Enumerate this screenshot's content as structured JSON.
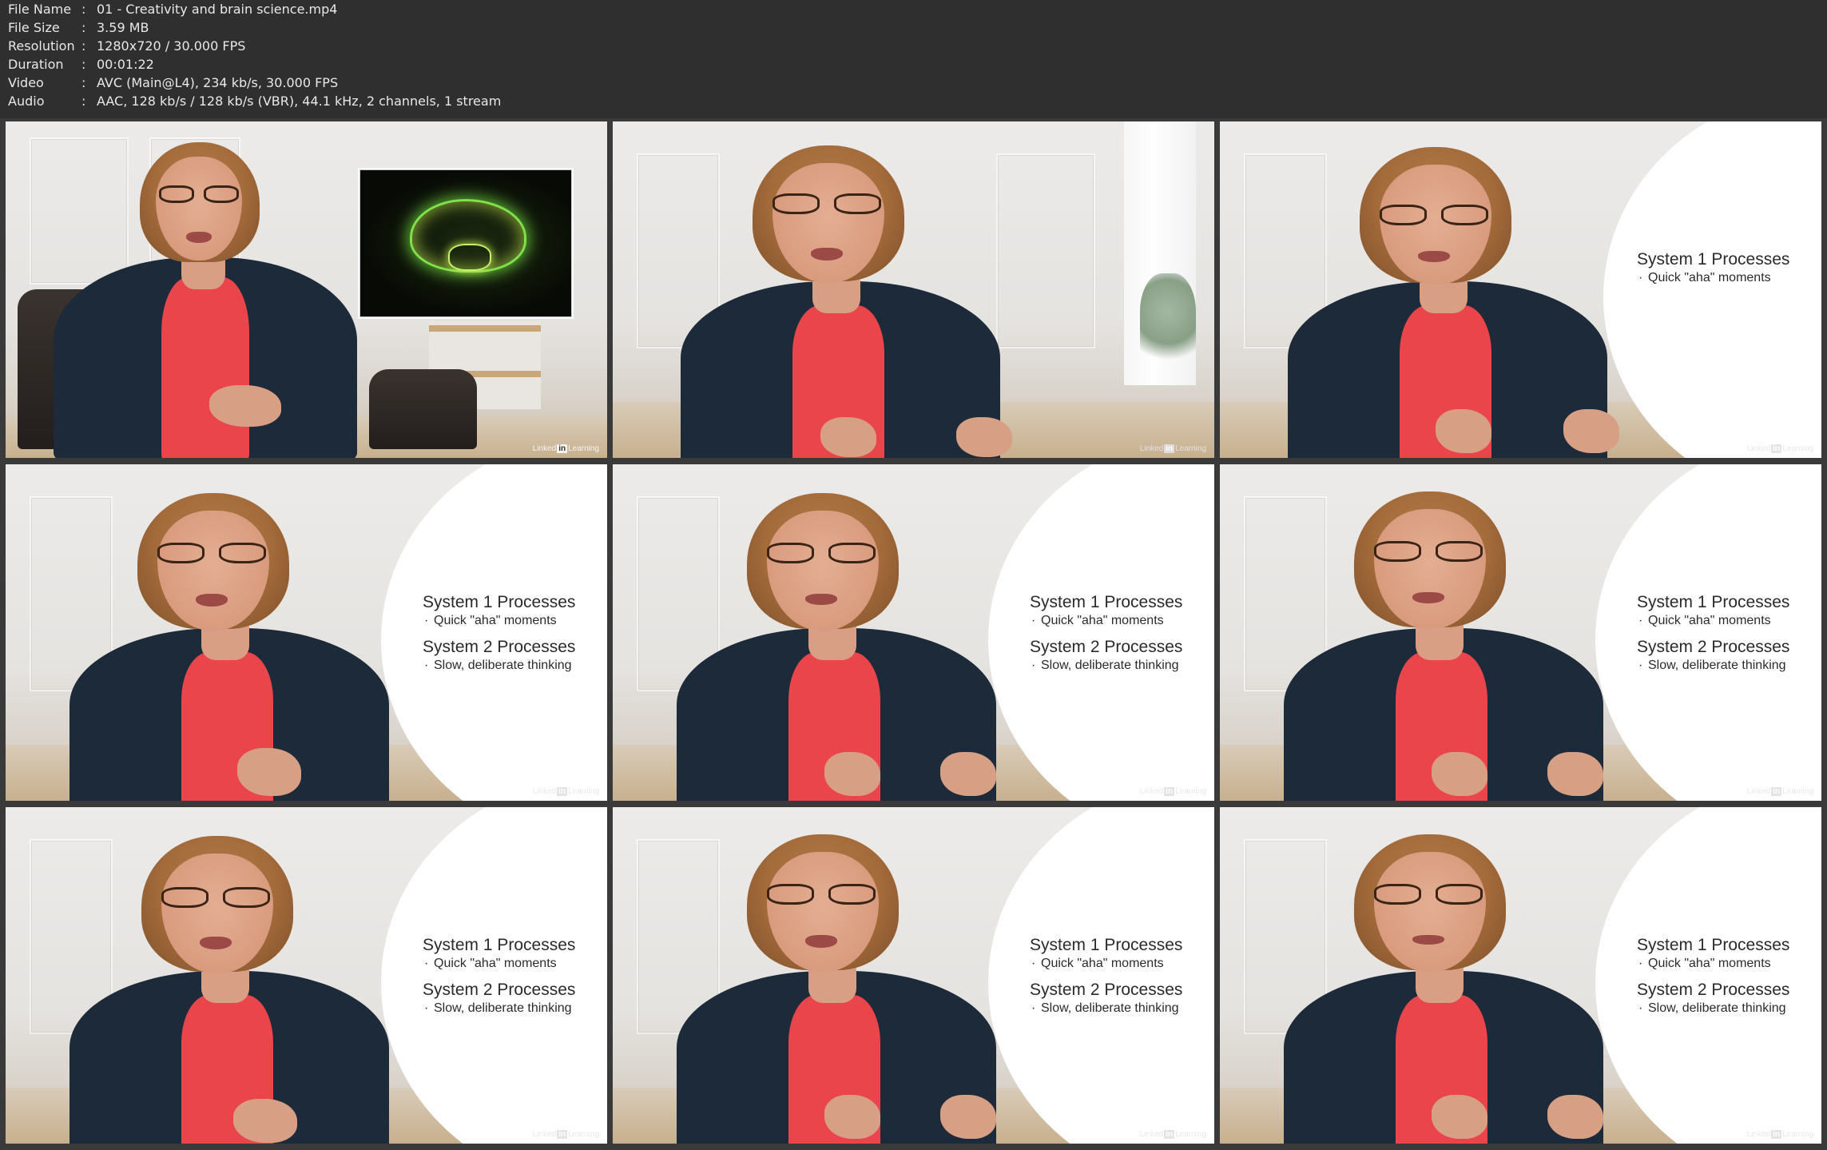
{
  "metadata": [
    {
      "key": "File Name",
      "value": "01 - Creativity and brain science.mp4"
    },
    {
      "key": "File Size",
      "value": "3.59 MB"
    },
    {
      "key": "Resolution",
      "value": "1280x720 / 30.000 FPS"
    },
    {
      "key": "Duration",
      "value": "00:01:22"
    },
    {
      "key": "Video",
      "value": "AVC (Main@L4), 234 kb/s, 30.000 FPS"
    },
    {
      "key": "Audio",
      "value": "AAC, 128 kb/s / 128 kb/s (VBR), 44.1 kHz, 2 channels, 1 stream"
    }
  ],
  "separator": ":",
  "slide": {
    "system1_title": "System 1 Processes",
    "system1_bullet": "Quick \"aha\" moments",
    "system2_title": "System 2 Processes",
    "system2_bullet": "Slow, deliberate thinking"
  },
  "watermark": {
    "left": "Linked",
    "box": "in",
    "right": "Learning"
  },
  "colors": {
    "background": "#2f2f2f",
    "jacket": "#1d2a3a",
    "shirt": "#e9454a",
    "hair": "#a36a3a",
    "brain_glow": "#7fe24a"
  }
}
